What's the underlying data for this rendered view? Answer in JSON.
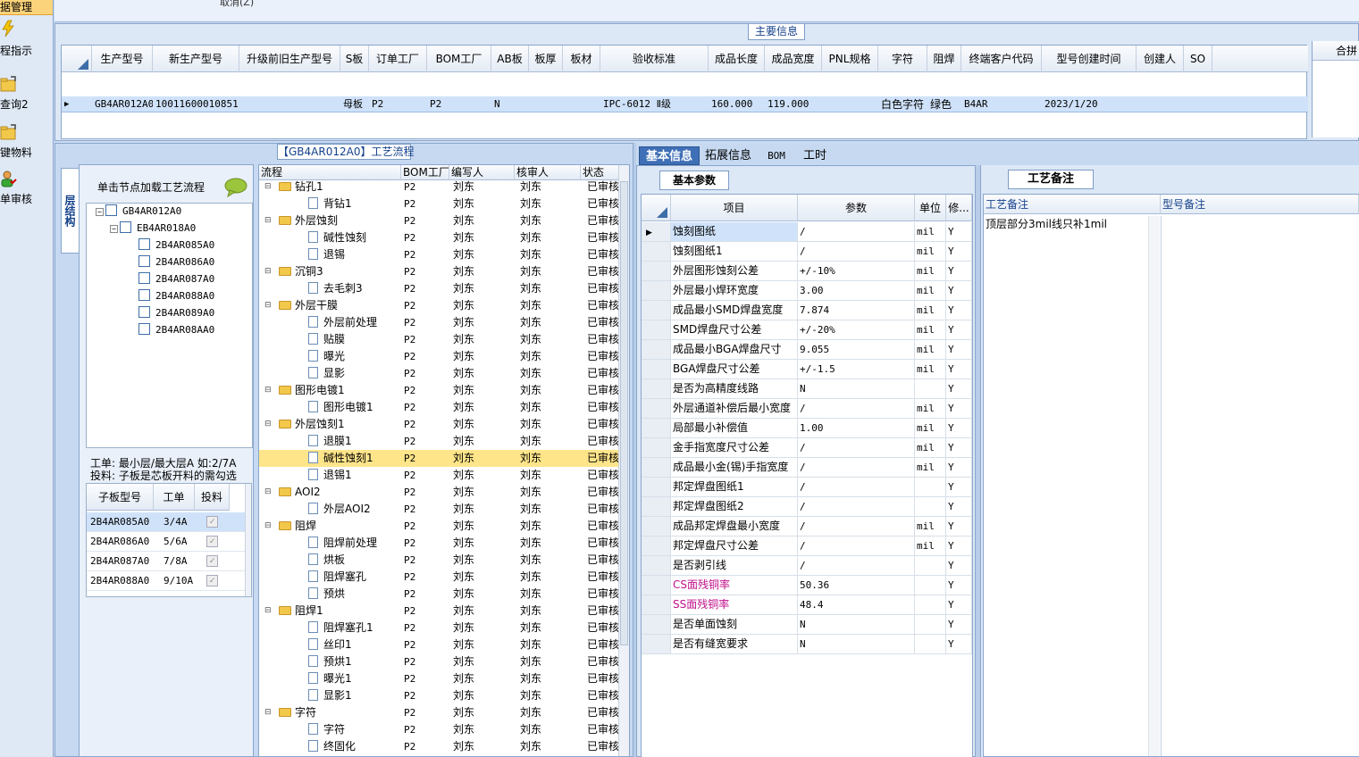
{
  "nav": {
    "top_label": "据管理",
    "items": [
      {
        "label": "程指示",
        "icon": "lightning-icon"
      },
      {
        "label": "查询2",
        "icon": "folder-icon"
      },
      {
        "label": "键物料",
        "icon": "folder-icon"
      },
      {
        "label": "单审核",
        "icon": "user-approve-icon"
      }
    ]
  },
  "topstrip": {
    "cancel_label": "取消(Z)"
  },
  "main_info": {
    "title": "主要信息",
    "columns": [
      "生产型号",
      "新生产型号",
      "升级前旧生产型号",
      "S板",
      "订单工厂",
      "BOM工厂",
      "AB板",
      "板厚",
      "板材",
      "验收标准",
      "成品长度",
      "成品宽度",
      "PNL规格",
      "字符",
      "阻焊",
      "终端客户代码",
      "型号创建时间",
      "创建人",
      "SO"
    ],
    "row": {
      "prod_model": "GB4AR012A0",
      "new_model": "10011600010851",
      "old_model": "",
      "s_board": "母板",
      "order_factory": "P2",
      "bom_factory": "P2",
      "ab_board": "N",
      "thickness": "",
      "material": "",
      "standard": "IPC-6012 Ⅱ级",
      "length": "160.000",
      "width": "119.000",
      "pnl": "",
      "char": "白色字符",
      "solder_mask": "绿色",
      "customer_code": "B4AR",
      "created": "2023/1/20",
      "creator": "",
      "so": ""
    },
    "right_header": "合拼"
  },
  "struct_panel": {
    "side_tab": "层结构",
    "hint": "单击节点加载工艺流程",
    "tree": [
      {
        "label": "GB4AR012A0",
        "level": 0
      },
      {
        "label": "EB4AR018A0",
        "level": 1
      },
      {
        "label": "2B4AR085A0",
        "level": 2
      },
      {
        "label": "2B4AR086A0",
        "level": 2
      },
      {
        "label": "2B4AR087A0",
        "level": 2
      },
      {
        "label": "2B4AR088A0",
        "level": 2
      },
      {
        "label": "2B4AR089A0",
        "level": 2
      },
      {
        "label": "2B4AR08AA0",
        "level": 2
      }
    ],
    "note_line1": "工单: 最小层/最大层A 如:2/7A",
    "note_line2": "投料: 子板是芯板开料的需勾选",
    "sub_columns": [
      "子板型号",
      "工单",
      "投料"
    ],
    "sub_rows": [
      {
        "model": "2B4AR085A0",
        "order": "3/4A"
      },
      {
        "model": "2B4AR086A0",
        "order": "5/6A"
      },
      {
        "model": "2B4AR087A0",
        "order": "7/8A"
      },
      {
        "model": "2B4AR088A0",
        "order": "9/10A"
      }
    ]
  },
  "process": {
    "title": "【GB4AR012A0】工艺流程",
    "columns": [
      "流程",
      "BOM工厂",
      "编写人",
      "核审人",
      "状态"
    ],
    "rows": [
      {
        "name": "钻孔1",
        "folder": true,
        "bom": "P2",
        "writer": "刘东",
        "reviewer": "刘东",
        "status": "已审核"
      },
      {
        "name": "背钻1",
        "folder": false,
        "bom": "P2",
        "writer": "刘东",
        "reviewer": "刘东",
        "status": "已审核"
      },
      {
        "name": "外层蚀刻",
        "folder": true,
        "bom": "P2",
        "writer": "刘东",
        "reviewer": "刘东",
        "status": "已审核"
      },
      {
        "name": "碱性蚀刻",
        "folder": false,
        "bom": "P2",
        "writer": "刘东",
        "reviewer": "刘东",
        "status": "已审核"
      },
      {
        "name": "退锡",
        "folder": false,
        "bom": "P2",
        "writer": "刘东",
        "reviewer": "刘东",
        "status": "已审核"
      },
      {
        "name": "沉铜3",
        "folder": true,
        "bom": "P2",
        "writer": "刘东",
        "reviewer": "刘东",
        "status": "已审核"
      },
      {
        "name": "去毛刺3",
        "folder": false,
        "bom": "P2",
        "writer": "刘东",
        "reviewer": "刘东",
        "status": "已审核"
      },
      {
        "name": "外层干膜",
        "folder": true,
        "bom": "P2",
        "writer": "刘东",
        "reviewer": "刘东",
        "status": "已审核"
      },
      {
        "name": "外层前处理",
        "folder": false,
        "bom": "P2",
        "writer": "刘东",
        "reviewer": "刘东",
        "status": "已审核"
      },
      {
        "name": "贴膜",
        "folder": false,
        "bom": "P2",
        "writer": "刘东",
        "reviewer": "刘东",
        "status": "已审核"
      },
      {
        "name": "曝光",
        "folder": false,
        "bom": "P2",
        "writer": "刘东",
        "reviewer": "刘东",
        "status": "已审核"
      },
      {
        "name": "显影",
        "folder": false,
        "bom": "P2",
        "writer": "刘东",
        "reviewer": "刘东",
        "status": "已审核"
      },
      {
        "name": "图形电镀1",
        "folder": true,
        "bom": "P2",
        "writer": "刘东",
        "reviewer": "刘东",
        "status": "已审核"
      },
      {
        "name": "图形电镀1",
        "folder": false,
        "bom": "P2",
        "writer": "刘东",
        "reviewer": "刘东",
        "status": "已审核"
      },
      {
        "name": "外层蚀刻1",
        "folder": true,
        "bom": "P2",
        "writer": "刘东",
        "reviewer": "刘东",
        "status": "已审核"
      },
      {
        "name": "退膜1",
        "folder": false,
        "bom": "P2",
        "writer": "刘东",
        "reviewer": "刘东",
        "status": "已审核"
      },
      {
        "name": "碱性蚀刻1",
        "folder": false,
        "bom": "P2",
        "writer": "刘东",
        "reviewer": "刘东",
        "status": "已审核",
        "selected": true
      },
      {
        "name": "退锡1",
        "folder": false,
        "bom": "P2",
        "writer": "刘东",
        "reviewer": "刘东",
        "status": "已审核"
      },
      {
        "name": "AOI2",
        "folder": true,
        "bom": "P2",
        "writer": "刘东",
        "reviewer": "刘东",
        "status": "已审核"
      },
      {
        "name": "外层AOI2",
        "folder": false,
        "bom": "P2",
        "writer": "刘东",
        "reviewer": "刘东",
        "status": "已审核"
      },
      {
        "name": "阻焊",
        "folder": true,
        "bom": "P2",
        "writer": "刘东",
        "reviewer": "刘东",
        "status": "已审核"
      },
      {
        "name": "阻焊前处理",
        "folder": false,
        "bom": "P2",
        "writer": "刘东",
        "reviewer": "刘东",
        "status": "已审核"
      },
      {
        "name": "烘板",
        "folder": false,
        "bom": "P2",
        "writer": "刘东",
        "reviewer": "刘东",
        "status": "已审核"
      },
      {
        "name": "阻焊塞孔",
        "folder": false,
        "bom": "P2",
        "writer": "刘东",
        "reviewer": "刘东",
        "status": "已审核"
      },
      {
        "name": "预烘",
        "folder": false,
        "bom": "P2",
        "writer": "刘东",
        "reviewer": "刘东",
        "status": "已审核"
      },
      {
        "name": "阻焊1",
        "folder": true,
        "bom": "P2",
        "writer": "刘东",
        "reviewer": "刘东",
        "status": "已审核"
      },
      {
        "name": "阻焊塞孔1",
        "folder": false,
        "bom": "P2",
        "writer": "刘东",
        "reviewer": "刘东",
        "status": "已审核"
      },
      {
        "name": "丝印1",
        "folder": false,
        "bom": "P2",
        "writer": "刘东",
        "reviewer": "刘东",
        "status": "已审核"
      },
      {
        "name": "预烘1",
        "folder": false,
        "bom": "P2",
        "writer": "刘东",
        "reviewer": "刘东",
        "status": "已审核"
      },
      {
        "name": "曝光1",
        "folder": false,
        "bom": "P2",
        "writer": "刘东",
        "reviewer": "刘东",
        "status": "已审核"
      },
      {
        "name": "显影1",
        "folder": false,
        "bom": "P2",
        "writer": "刘东",
        "reviewer": "刘东",
        "status": "已审核"
      },
      {
        "name": "字符",
        "folder": true,
        "bom": "P2",
        "writer": "刘东",
        "reviewer": "刘东",
        "status": "已审核"
      },
      {
        "name": "字符",
        "folder": false,
        "bom": "P2",
        "writer": "刘东",
        "reviewer": "刘东",
        "status": "已审核"
      },
      {
        "name": "终固化",
        "folder": false,
        "bom": "P2",
        "writer": "刘东",
        "reviewer": "刘东",
        "status": "已审核"
      }
    ]
  },
  "tabs": [
    "基本信息",
    "拓展信息",
    "BOM",
    "工时"
  ],
  "basic": {
    "panel_tab": "基本参数",
    "columns": [
      "项目",
      "参数",
      "单位",
      "修..."
    ],
    "rows": [
      {
        "item": "蚀刻图纸",
        "value": "/",
        "unit": "mil",
        "flag": "Y"
      },
      {
        "item": "蚀刻图纸1",
        "value": "/",
        "unit": "mil",
        "flag": "Y"
      },
      {
        "item": "外层图形蚀刻公差",
        "value": "+/-10%",
        "unit": "mil",
        "flag": "Y"
      },
      {
        "item": "外层最小焊环宽度",
        "value": "3.00",
        "unit": "mil",
        "flag": "Y"
      },
      {
        "item": "成品最小SMD焊盘宽度",
        "value": "7.874",
        "unit": "mil",
        "flag": "Y"
      },
      {
        "item": "SMD焊盘尺寸公差",
        "value": "+/-20%",
        "unit": "mil",
        "flag": "Y"
      },
      {
        "item": "成品最小BGA焊盘尺寸",
        "value": "9.055",
        "unit": "mil",
        "flag": "Y"
      },
      {
        "item": "BGA焊盘尺寸公差",
        "value": "+/-1.5",
        "unit": "mil",
        "flag": "Y"
      },
      {
        "item": "是否为高精度线路",
        "value": "N",
        "unit": "",
        "flag": "Y"
      },
      {
        "item": "外层通道补偿后最小宽度",
        "value": "/",
        "unit": "mil",
        "flag": "Y"
      },
      {
        "item": "局部最小补偿值",
        "value": "1.00",
        "unit": "mil",
        "flag": "Y"
      },
      {
        "item": "金手指宽度尺寸公差",
        "value": "/",
        "unit": "mil",
        "flag": "Y"
      },
      {
        "item": "成品最小金(锡)手指宽度",
        "value": "/",
        "unit": "mil",
        "flag": "Y"
      },
      {
        "item": "邦定焊盘图纸1",
        "value": "/",
        "unit": "",
        "flag": "Y"
      },
      {
        "item": "邦定焊盘图纸2",
        "value": "/",
        "unit": "",
        "flag": "Y"
      },
      {
        "item": "成品邦定焊盘最小宽度",
        "value": "/",
        "unit": "mil",
        "flag": "Y"
      },
      {
        "item": "邦定焊盘尺寸公差",
        "value": "/",
        "unit": "mil",
        "flag": "Y"
      },
      {
        "item": "是否剥引线",
        "value": "/",
        "unit": "",
        "flag": "Y"
      },
      {
        "item": "CS面残铜率",
        "value": "50.36",
        "unit": "",
        "flag": "Y",
        "pink": true
      },
      {
        "item": "SS面残铜率",
        "value": "48.4",
        "unit": "",
        "flag": "Y",
        "pink": true
      },
      {
        "item": "是否单面蚀刻",
        "value": "N",
        "unit": "",
        "flag": "Y"
      },
      {
        "item": "是否有缝宽要求",
        "value": "N",
        "unit": "",
        "flag": "Y"
      }
    ]
  },
  "notes": {
    "panel_tab": "工艺备注",
    "col1": "工艺备注",
    "col2": "型号备注",
    "content": "顶层部分3mil线只补1mil"
  },
  "colors": {
    "accent": "#3f6fb6",
    "selected_row": "#cfe2fa",
    "highlight_row": "#ffe58a",
    "pink_text": "#c0108a"
  }
}
